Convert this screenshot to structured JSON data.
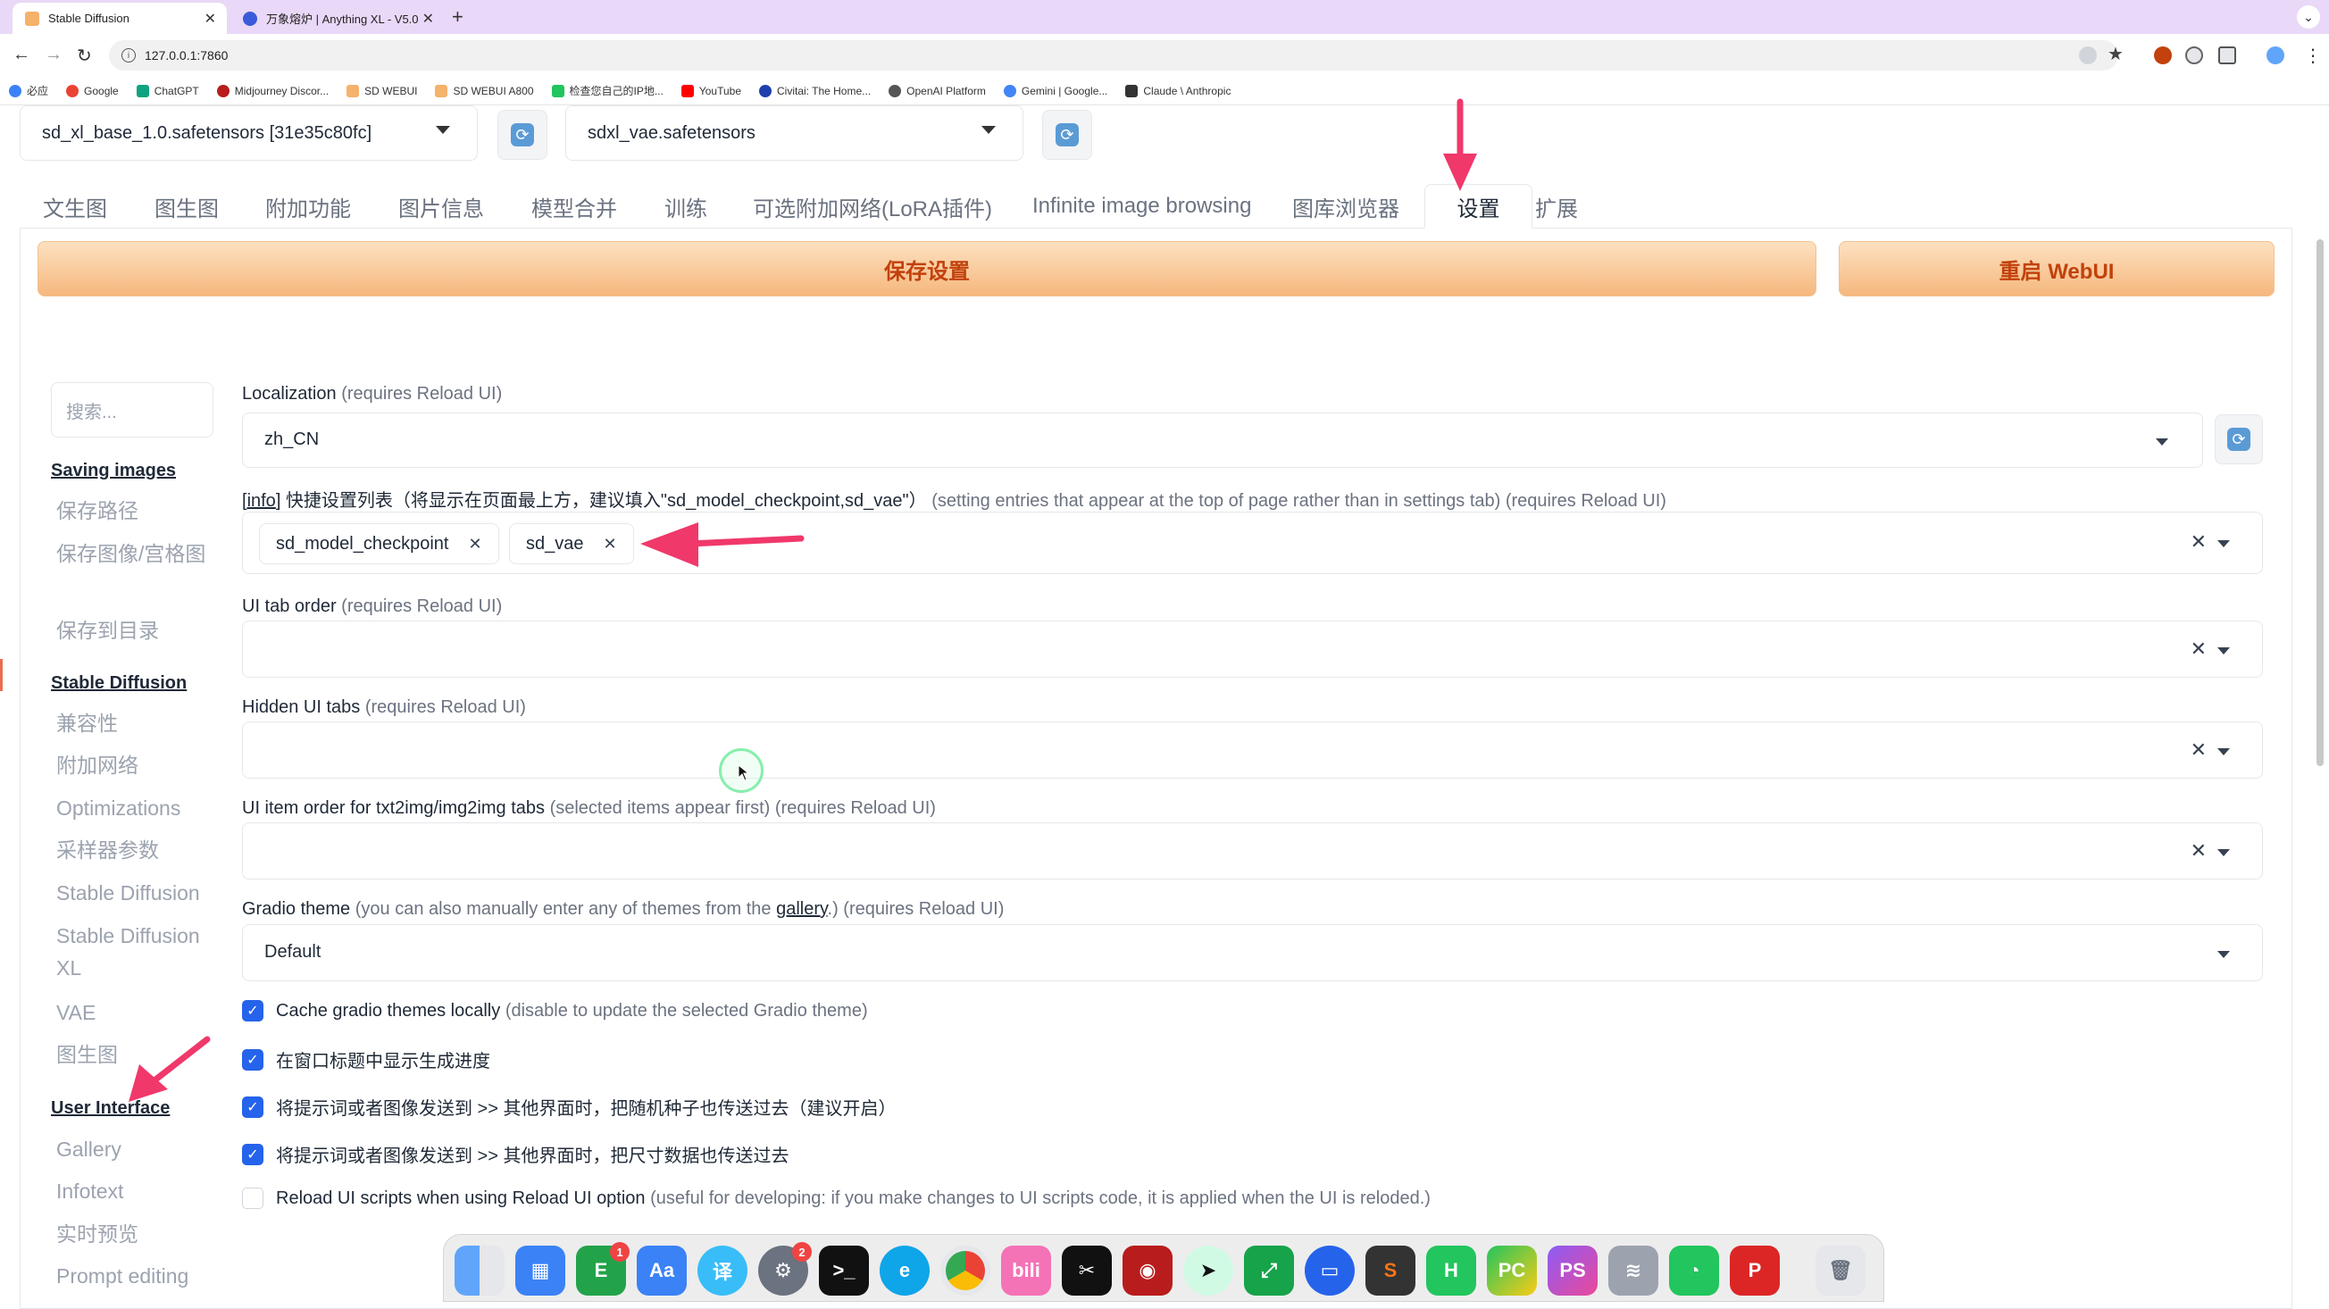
{
  "browser": {
    "tabs": [
      {
        "title": "Stable Diffusion",
        "active": true
      },
      {
        "title": "万象熔炉 | Anything XL - V5.0",
        "active": false
      }
    ],
    "new_tab": "+",
    "url": "127.0.0.1:7860",
    "bookmarks": [
      "必应",
      "Google",
      "ChatGPT",
      "Midjourney Discor...",
      "SD WEBUI",
      "SD WEBUI A800",
      "检查您自己的IP地...",
      "YouTube",
      "Civitai: The Home...",
      "OpenAI Platform",
      "Gemini | Google...",
      "Claude \\ Anthropic"
    ]
  },
  "top": {
    "checkpoint": "sd_xl_base_1.0.safetensors [31e35c80fc]",
    "vae": "sdxl_vae.safetensors",
    "refresh_icon": "refresh-icon"
  },
  "tabs": [
    "文生图",
    "图生图",
    "附加功能",
    "图片信息",
    "模型合并",
    "训练",
    "可选附加网络(LoRA插件)",
    "Infinite image browsing",
    "图库浏览器",
    "设置",
    "扩展"
  ],
  "active_tab": "设置",
  "buttons": {
    "save": "保存设置",
    "restart": "重启 WebUI"
  },
  "sidebar": {
    "search_placeholder": "搜索...",
    "sections": [
      {
        "title": "Saving images",
        "items": [
          "保存路径",
          "保存图像/宫格图",
          "保存到目录"
        ]
      },
      {
        "title": "Stable Diffusion",
        "items": [
          "兼容性",
          "附加网络",
          "Optimizations",
          "采样器参数",
          "Stable Diffusion",
          "Stable Diffusion XL",
          "VAE",
          "图生图"
        ]
      },
      {
        "title": "User Interface",
        "items": [
          "Gallery",
          "Infotext",
          "实时预览",
          "Prompt editing"
        ]
      }
    ]
  },
  "settings": {
    "localization": {
      "label": "Localization",
      "note": "(requires Reload UI)",
      "value": "zh_CN"
    },
    "quicksettings": {
      "info": "info",
      "label": "快捷设置列表（将显示在页面最上方，建议填入\"sd_model_checkpoint,sd_vae\"）",
      "note": "(setting entries that appear at the top of page rather than in settings tab) (requires Reload UI)",
      "chips": [
        "sd_model_checkpoint",
        "sd_vae"
      ]
    },
    "tab_order": {
      "label": "UI tab order",
      "note": "(requires Reload UI)"
    },
    "hidden_tabs": {
      "label": "Hidden UI tabs",
      "note": "(requires Reload UI)"
    },
    "item_order": {
      "label": "UI item order for txt2img/img2img tabs",
      "note": "(selected items appear first) (requires Reload UI)"
    },
    "gradio_theme": {
      "label": "Gradio theme",
      "note_pre": "(you can also manually enter any of themes from the",
      "link": "gallery",
      "note_post": ".) (requires Reload UI)",
      "value": "Default"
    },
    "checkboxes": [
      {
        "label": "Cache gradio themes locally",
        "note": "(disable to update the selected Gradio theme)",
        "checked": true
      },
      {
        "label": "在窗口标题中显示生成进度",
        "note": "",
        "checked": true
      },
      {
        "label": "将提示词或者图像发送到 >> 其他界面时，把随机种子也传送过去（建议开启）",
        "note": "",
        "checked": true
      },
      {
        "label": "将提示词或者图像发送到 >> 其他界面时，把尺寸数据也传送过去",
        "note": "",
        "checked": true
      },
      {
        "label": "Reload UI scripts when using Reload UI option",
        "note": "(useful for developing: if you make changes to UI scripts code, it is applied when the UI is reloded.)",
        "checked": false
      }
    ],
    "clear_symbol": "✕"
  },
  "dock": {
    "apps": [
      "Finder",
      "Launchpad",
      "Evernote",
      "Dictionary",
      "Translate",
      "System Settings",
      "Terminal",
      "Edge",
      "Chrome",
      "Bilibili",
      "CapCut",
      "Photo Booth",
      "Cursor",
      "Screenshot",
      "Zoom",
      "Sublime Text",
      "HBuilder",
      "PyCharm",
      "PhpStorm",
      "Sequel Pro",
      "WeChat",
      "PowerPoint",
      "Trash"
    ],
    "badges": {
      "evernote": "1",
      "settings": "2"
    }
  },
  "colors": {
    "accent_orange": "#c2410c",
    "annotation_arrow": "#f0386b",
    "checkbox": "#2563eb",
    "tabbar": "#e9d8f7"
  }
}
